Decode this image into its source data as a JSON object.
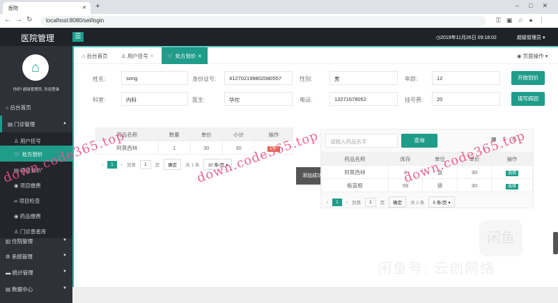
{
  "browser": {
    "tab_title": "医院",
    "url": "localhost:8080/sel/login"
  },
  "header": {
    "app_title": "医院管理",
    "datetime": "2019年11月26日 09:18:02",
    "user": "超级管理员"
  },
  "sidebar": {
    "welcome": "你好! 超级管理员, 欢迎登录",
    "items": [
      {
        "label": "后台首页"
      },
      {
        "label": "门诊管理"
      },
      {
        "label": "用户挂号"
      },
      {
        "label": "处方划价"
      },
      {
        "label": "项目划价"
      },
      {
        "label": "项目缴费"
      },
      {
        "label": "项目检查"
      },
      {
        "label": "药品缴费"
      },
      {
        "label": "门诊患者库"
      },
      {
        "label": "住院管理"
      },
      {
        "label": "系统管理"
      },
      {
        "label": "统计管理"
      },
      {
        "label": "数据中心"
      }
    ]
  },
  "tabs": [
    {
      "label": "后台首页"
    },
    {
      "label": "用户挂号"
    },
    {
      "label": "处方划价"
    }
  ],
  "page_ops": "页面操作",
  "form": {
    "name_label": "姓名:",
    "name": "song",
    "id_label": "身份证号:",
    "id": "412702199802080557",
    "gender_label": "性别:",
    "gender": "男",
    "age_label": "年龄:",
    "age": "12",
    "dept_label": "科室:",
    "dept": "内科",
    "doctor_label": "医生:",
    "doctor": "华佗",
    "phone_label": "电话:",
    "phone": "13271678052",
    "fee_label": "挂号费:",
    "fee": "20",
    "start_btn": "开始划价",
    "cause_btn": "填写病因"
  },
  "rx_table": {
    "headers": [
      "药品名称",
      "数量",
      "单价",
      "小计",
      "操作"
    ],
    "rows": [
      {
        "name": "阿莫西林",
        "qty": "1",
        "price": "30",
        "subtotal": "30",
        "action": "删除"
      }
    ],
    "pager": {
      "page": "1",
      "goto": "到第",
      "page_input": "1",
      "page_unit": "页",
      "confirm": "确定",
      "total": "共 1 条",
      "per_page": "10 条/页"
    }
  },
  "toast": "添加成功",
  "drug_panel": {
    "search_placeholder": "请输入药品名字",
    "search_btn": "查询",
    "headers": [
      "药品名称",
      "库存",
      "单位",
      "单价",
      "操作"
    ],
    "rows": [
      {
        "name": "阿莫西林",
        "stock": "8",
        "unit": "盒",
        "price": "30",
        "action": "选择"
      },
      {
        "name": "板蓝根",
        "stock": "59",
        "unit": "袋",
        "price": "30",
        "action": "选择"
      }
    ],
    "pager": {
      "page": "1",
      "goto": "到第",
      "page_input": "1",
      "page_unit": "页",
      "confirm": "确定",
      "total": "共 2 条",
      "per_page": "5 条/页"
    }
  },
  "watermark": {
    "text": "down.code365.top",
    "brand": "闲鱼号: 云创网络",
    "logo": "闲鱼"
  },
  "colors": {
    "accent": "#1f9c8a",
    "header": "#20222a",
    "sidebar": "#2f3138",
    "danger": "#e0653a"
  }
}
